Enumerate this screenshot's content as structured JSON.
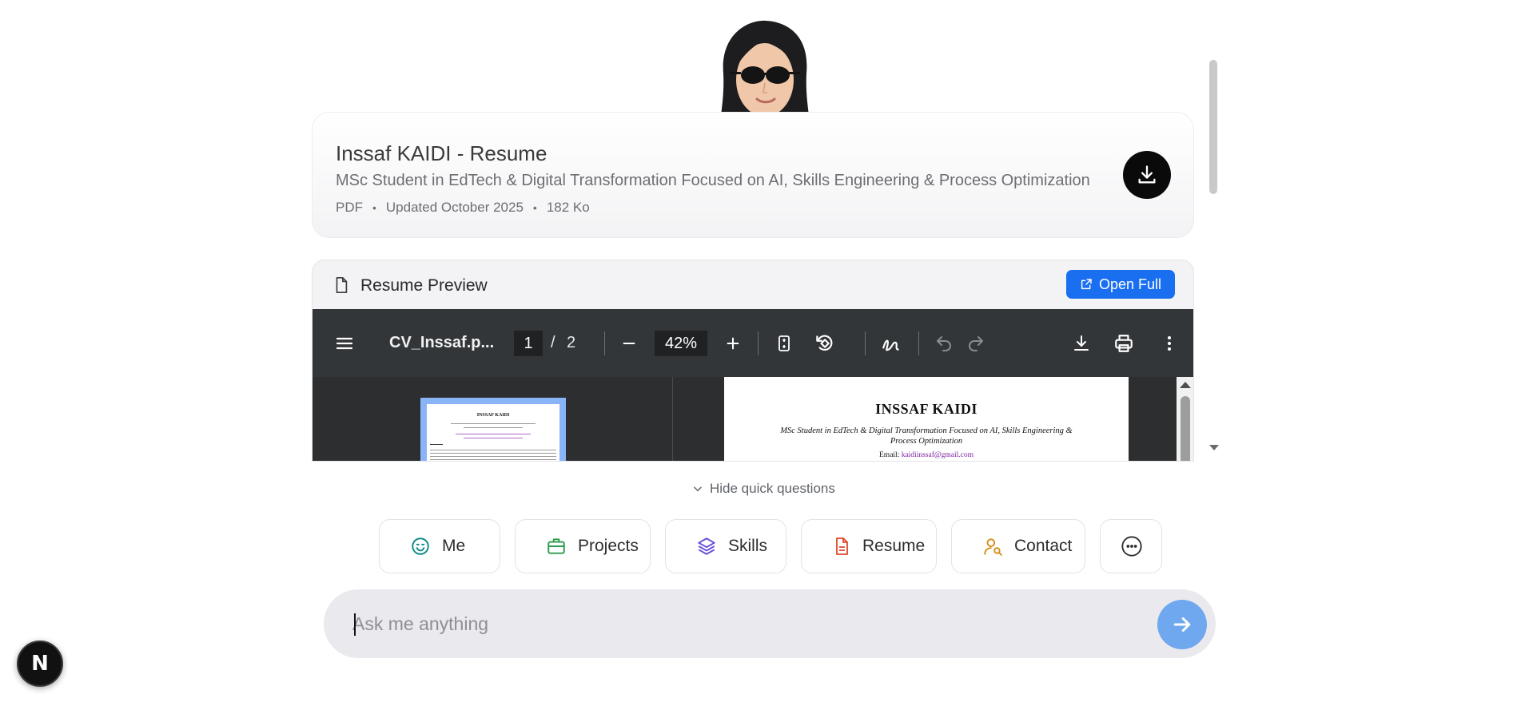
{
  "resume": {
    "title": "Inssaf KAIDI - Resume",
    "subtitle": "MSc Student in EdTech & Digital Transformation Focused on AI, Skills Engineering & Process Optimization",
    "format": "PDF",
    "updated": "Updated October 2025",
    "size": "182 Ko",
    "download_icon": "download-icon"
  },
  "preview": {
    "title": "Resume Preview",
    "open_full_label": "Open Full",
    "toolbar": {
      "filename": "CV_Inssaf.p...",
      "page_current": "1",
      "page_separator": "/",
      "page_total": "2",
      "zoom": "42%"
    },
    "document": {
      "name": "INSSAF KAIDI",
      "subtitle": "MSc Student in EdTech & Digital Transformation Focused on AI, Skills Engineering & Process Optimization",
      "email_label": "Email:",
      "email": "kaidiinssaf@gmail.com"
    },
    "thumbnail_title": "INSSAF KAIDI"
  },
  "quick": {
    "toggle_label": "Hide quick questions",
    "chips": [
      {
        "label": "Me",
        "icon": "smile-icon",
        "color": "#0f8a8a"
      },
      {
        "label": "Projects",
        "icon": "briefcase-icon",
        "color": "#2e9b4e"
      },
      {
        "label": "Skills",
        "icon": "layers-icon",
        "color": "#6a4fd8"
      },
      {
        "label": "Resume",
        "icon": "file-text-icon",
        "color": "#e0452c"
      },
      {
        "label": "Contact",
        "icon": "user-search-icon",
        "color": "#d6901f"
      }
    ],
    "more_icon": "more-horizontal-icon"
  },
  "ask": {
    "placeholder": "Ask me anything"
  },
  "badge": {
    "label": "N"
  },
  "colors": {
    "accent": "#1a6ff0",
    "send": "#6fa8ee",
    "toolbar": "#323639"
  }
}
